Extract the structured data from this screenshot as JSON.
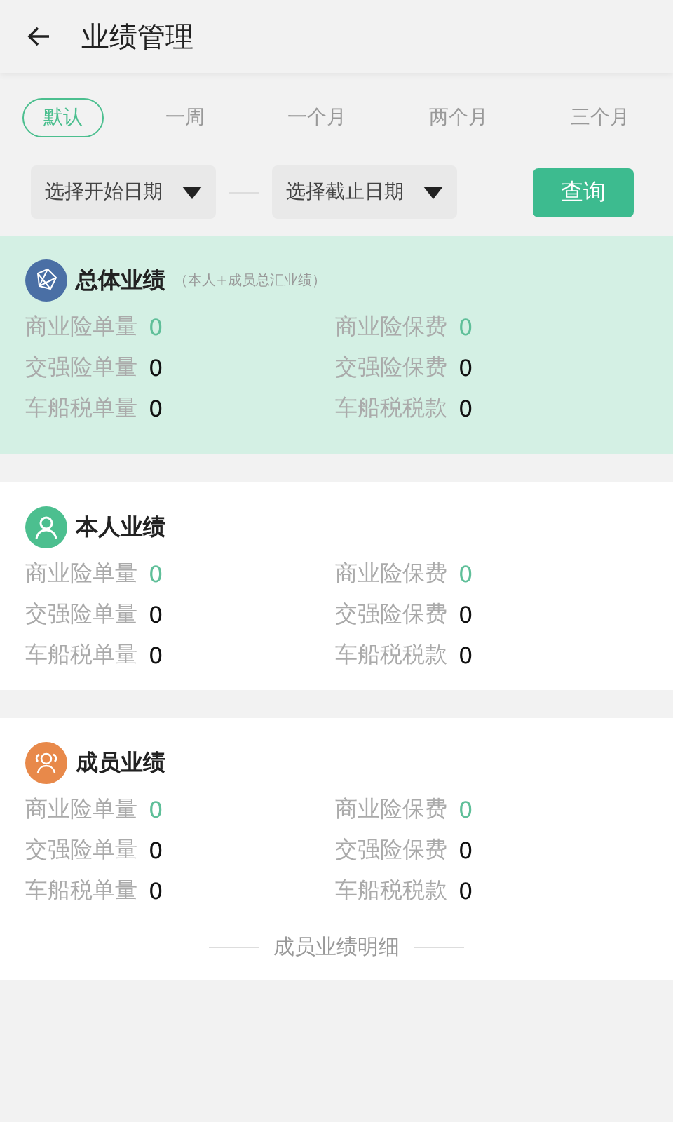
{
  "header": {
    "title": "业绩管理"
  },
  "periods": [
    {
      "label": "默认",
      "selected": true
    },
    {
      "label": "一周",
      "selected": false
    },
    {
      "label": "一个月",
      "selected": false
    },
    {
      "label": "两个月",
      "selected": false
    },
    {
      "label": "三个月",
      "selected": false
    }
  ],
  "date_range": {
    "start": {
      "placeholder": "选择开始日期"
    },
    "end": {
      "placeholder": "选择截止日期"
    },
    "query_button": "查询"
  },
  "sections": [
    {
      "kind": "total",
      "title": "总体业绩",
      "subtitle": "（本人+成员总汇业绩）",
      "color": "#4a6fa5",
      "stats": [
        {
          "label": "商业险单量",
          "value": "0",
          "highlighted": true
        },
        {
          "label": "商业险保费",
          "value": "0",
          "highlighted": true
        },
        {
          "label": "交强险单量",
          "value": "0",
          "highlighted": false
        },
        {
          "label": "交强险保费",
          "value": "0",
          "highlighted": false
        },
        {
          "label": "车船税单量",
          "value": "0",
          "highlighted": false
        },
        {
          "label": "车船税税款",
          "value": "0",
          "highlighted": false
        }
      ]
    },
    {
      "kind": "self",
      "title": "本人业绩",
      "color": "#4cbf8f",
      "stats": [
        {
          "label": "商业险单量",
          "value": "0",
          "highlighted": true
        },
        {
          "label": "商业险保费",
          "value": "0",
          "highlighted": true
        },
        {
          "label": "交强险单量",
          "value": "0",
          "highlighted": false
        },
        {
          "label": "交强险保费",
          "value": "0",
          "highlighted": false
        },
        {
          "label": "车船税单量",
          "value": "0",
          "highlighted": false
        },
        {
          "label": "车船税税款",
          "value": "0",
          "highlighted": false
        }
      ]
    },
    {
      "kind": "members",
      "title": "成员业绩",
      "color": "#e8894a",
      "detail_link": "成员业绩明细",
      "stats": [
        {
          "label": "商业险单量",
          "value": "0",
          "highlighted": true
        },
        {
          "label": "商业险保费",
          "value": "0",
          "highlighted": true
        },
        {
          "label": "交强险单量",
          "value": "0",
          "highlighted": false
        },
        {
          "label": "交强险保费",
          "value": "0",
          "highlighted": false
        },
        {
          "label": "车船税单量",
          "value": "0",
          "highlighted": false
        },
        {
          "label": "车船税税款",
          "value": "0",
          "highlighted": false
        }
      ]
    }
  ]
}
